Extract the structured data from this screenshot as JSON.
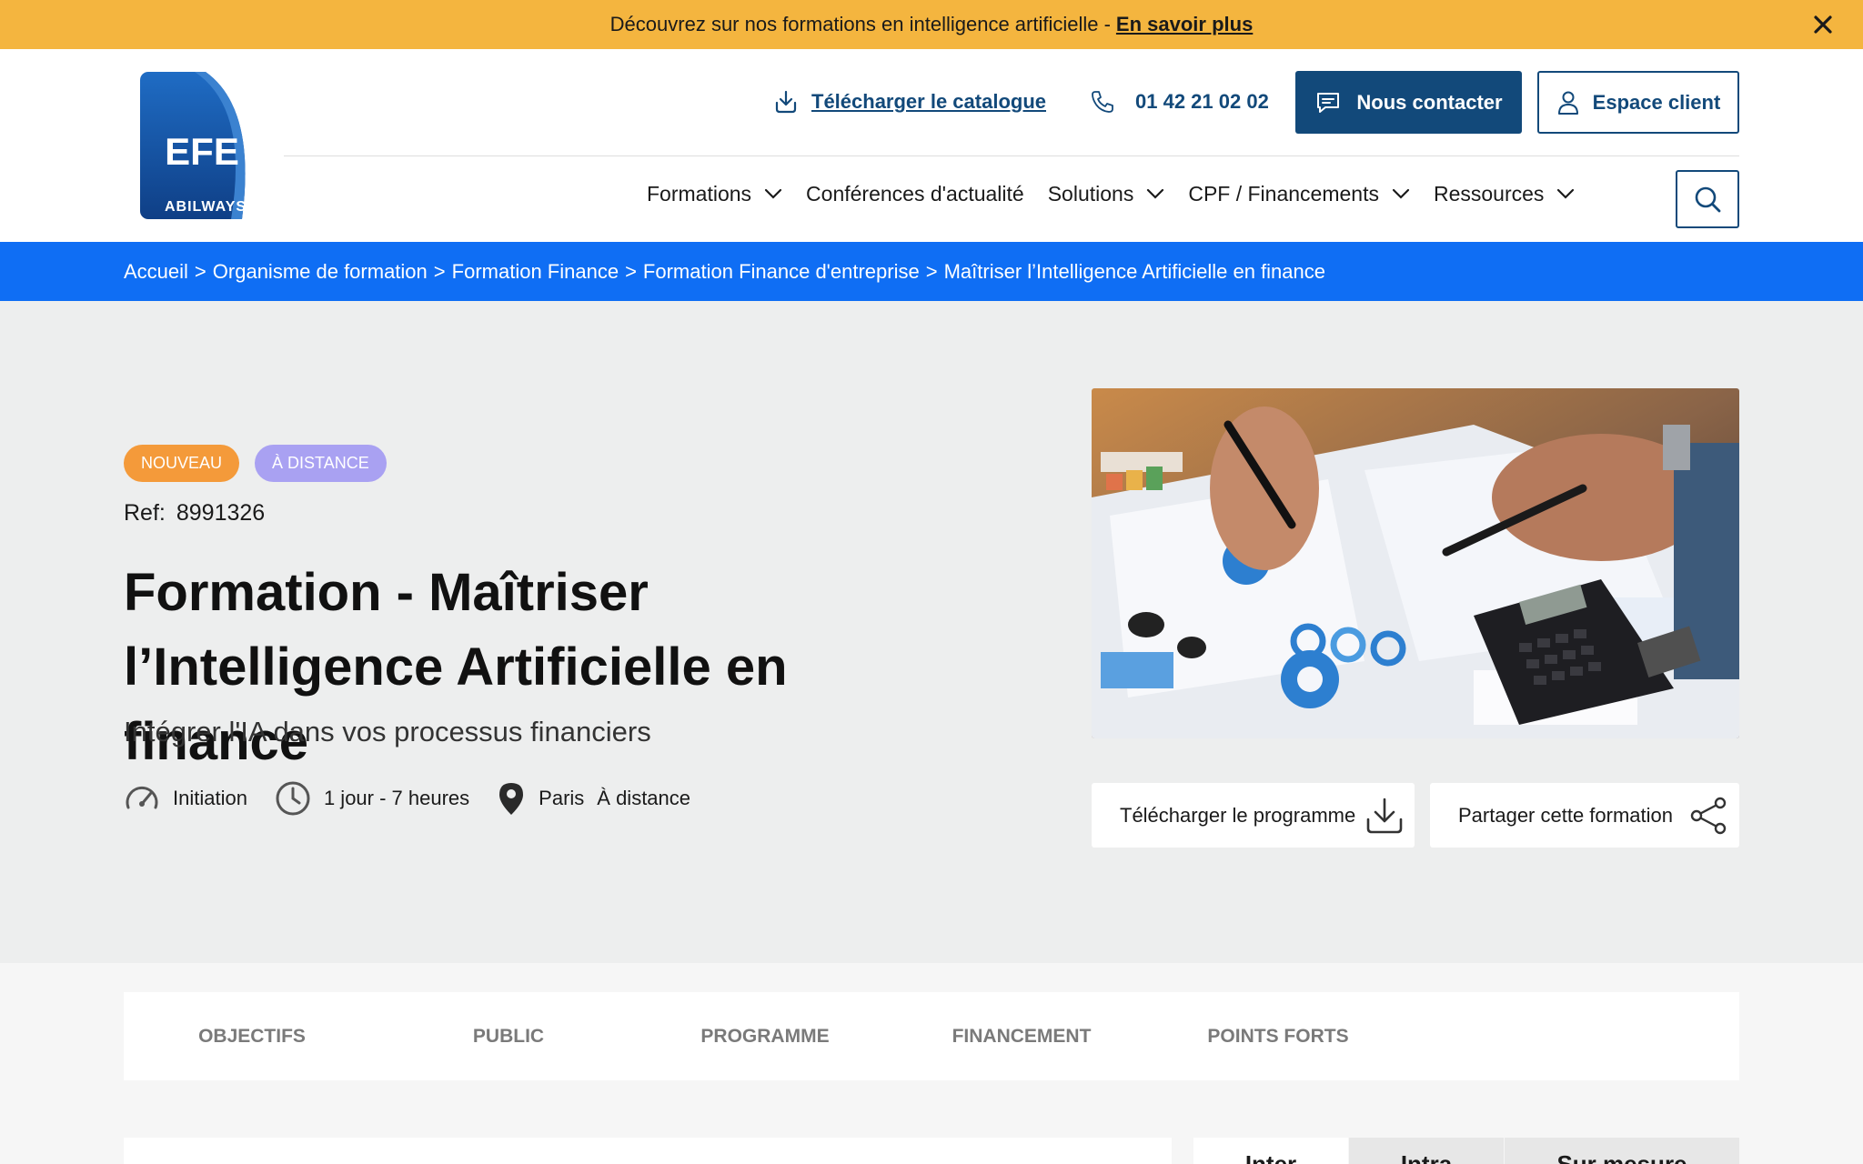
{
  "announcement": {
    "text": "Découvrez sur nos formations en intelligence artificielle -",
    "link": "En savoir plus"
  },
  "logo": {
    "name": "EFE",
    "tagline": "ABILWAYS"
  },
  "header": {
    "catalog_link": "Télécharger le catalogue",
    "phone": "01 42 21 02 02",
    "contact_button": "Nous contacter",
    "client_button": "Espace client"
  },
  "nav": {
    "items": [
      {
        "label": "Formations",
        "dropdown": true
      },
      {
        "label": "Conférences d'actualité",
        "dropdown": false
      },
      {
        "label": "Solutions",
        "dropdown": true
      },
      {
        "label": "CPF / Financements",
        "dropdown": true
      },
      {
        "label": "Ressources",
        "dropdown": true
      }
    ]
  },
  "breadcrumb": {
    "items": [
      "Accueil",
      "Organisme de formation",
      "Formation Finance",
      "Formation Finance d'entreprise",
      "Maîtriser l’Intelligence Artificielle en finance"
    ],
    "separator": ">"
  },
  "hero": {
    "badges": [
      "NOUVEAU",
      "À DISTANCE"
    ],
    "ref_label": "Ref:",
    "ref_value": "8991326",
    "title": "Formation - Maîtriser l’Intelligence Artificielle en finance",
    "subtitle": "Intégrer l'IA dans vos processus financiers",
    "level": "Initiation",
    "duration": "1 jour - 7 heures",
    "location": "Paris",
    "mode": "À distance",
    "download_button": "Télécharger le programme",
    "share_button": "Partager cette formation"
  },
  "tabs": [
    "OBJECTIFS",
    "PUBLIC",
    "PROGRAMME",
    "FINANCEMENT",
    "POINTS FORTS"
  ],
  "pricing_tabs": [
    "Inter",
    "Intra",
    "Sur mesure"
  ],
  "colors": {
    "announce_bg": "#f4b53f",
    "primary_dark": "#12497a",
    "breadcrumb_bg": "#0f6ef4",
    "badge_new": "#f49a3a",
    "badge_remote": "#a9a1f2",
    "hero_bg": "#edeeee"
  },
  "icons": [
    "close-icon",
    "download-icon",
    "phone-icon",
    "chat-icon",
    "user-icon",
    "chevron-down-icon",
    "search-icon",
    "gauge-icon",
    "clock-icon",
    "location-pin-icon",
    "share-icon"
  ]
}
